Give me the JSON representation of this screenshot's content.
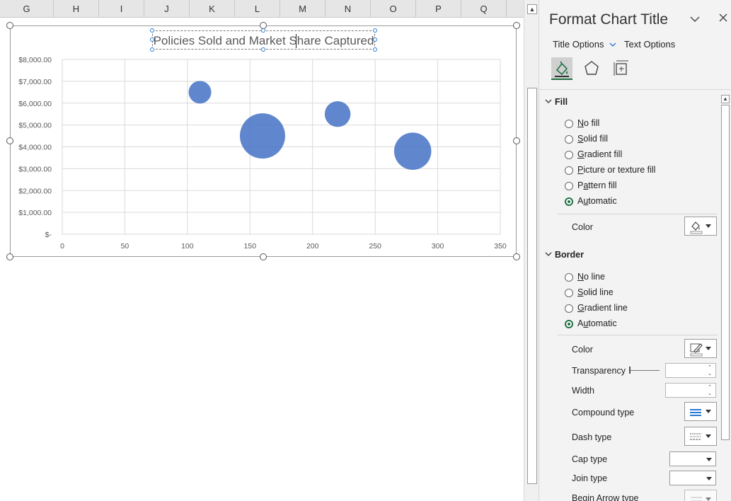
{
  "sheet": {
    "columns": [
      "G",
      "H",
      "I",
      "J",
      "K",
      "L",
      "M",
      "N",
      "O",
      "P",
      "Q"
    ]
  },
  "chart": {
    "title": "Policies Sold and Market Share Captured"
  },
  "chart_data": {
    "type": "scatter",
    "subtype": "bubble",
    "title": "Policies Sold and Market Share Captured",
    "xlabel": "",
    "ylabel": "",
    "xlim": [
      0,
      350
    ],
    "ylim": [
      0,
      8000
    ],
    "x_ticks": [
      "0",
      "50",
      "100",
      "150",
      "200",
      "250",
      "300",
      "350"
    ],
    "y_ticks": [
      "$-",
      "$1,000.00",
      "$2,000.00",
      "$3,000.00",
      "$4,000.00",
      "$5,000.00",
      "$6,000.00",
      "$7,000.00",
      "$8,000.00"
    ],
    "grid": true,
    "legend": "none",
    "series": [
      {
        "color": "#4472c4",
        "points": [
          {
            "x": 110,
            "y": 6500,
            "size": 1.0
          },
          {
            "x": 160,
            "y": 4500,
            "size": 4.0
          },
          {
            "x": 220,
            "y": 5500,
            "size": 1.3
          },
          {
            "x": 280,
            "y": 3800,
            "size": 2.7
          }
        ]
      }
    ]
  },
  "pane": {
    "title": "Format Chart Title",
    "tabs": {
      "title_options": "Title Options",
      "text_options": "Text Options"
    },
    "icons": [
      "fill-line-icon",
      "effects-icon",
      "size-properties-icon"
    ],
    "fill": {
      "header": "Fill",
      "options": [
        {
          "label": "No fill",
          "u": "N",
          "rest": "o fill",
          "selected": false
        },
        {
          "label": "Solid fill",
          "u": "S",
          "rest": "olid fill",
          "selected": false
        },
        {
          "label": "Gradient fill",
          "u": "G",
          "rest": "radient fill",
          "selected": false
        },
        {
          "label": "Picture or texture fill",
          "u": "P",
          "rest": "icture or texture fill",
          "selected": false
        },
        {
          "label": "Pattern fill",
          "u": "A",
          "rest": "Pattern fill",
          "selected": false
        },
        {
          "label": "Automatic",
          "u": "U",
          "rest": "Automatic",
          "selected": true
        }
      ],
      "color_label": "Color"
    },
    "border": {
      "header": "Border",
      "options": [
        {
          "label": "No line",
          "u": "N",
          "rest": "o line",
          "selected": false
        },
        {
          "label": "Solid line",
          "u": "S",
          "rest": "olid line",
          "selected": false
        },
        {
          "label": "Gradient line",
          "u": "G",
          "rest": "radient line",
          "selected": false
        },
        {
          "label": "Automatic",
          "u": "U",
          "rest": "Automatic",
          "selected": true
        }
      ],
      "color_label": "Color",
      "transparency_label": "Transparency",
      "width_label": "Width",
      "compound_label": "Compound type",
      "dash_label": "Dash type",
      "cap_label": "Cap type",
      "join_label": "Join type",
      "begin_arrow_label": "Begin Arrow type"
    }
  }
}
